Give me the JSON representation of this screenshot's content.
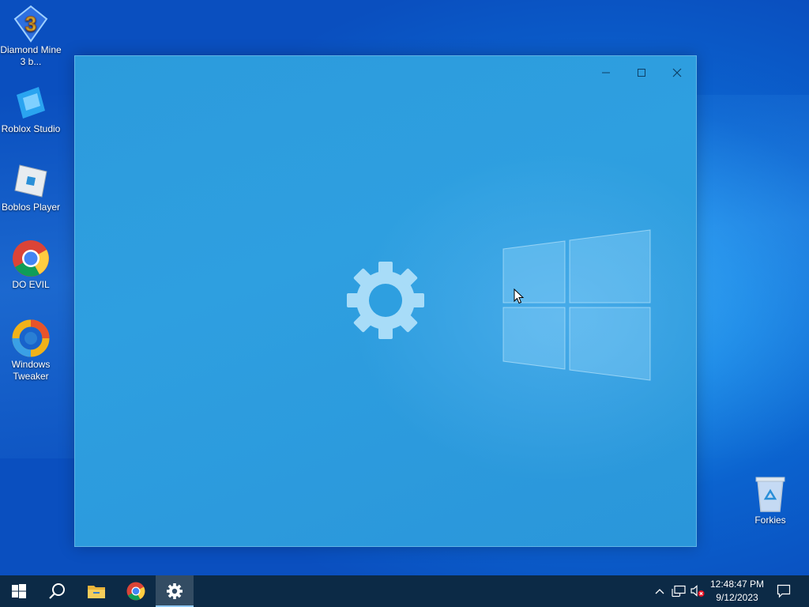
{
  "desktop": {
    "icons": [
      {
        "label": "Diamond Mine 3 b...",
        "icon": "diamond-mine-icon"
      },
      {
        "label": "Roblox Studio",
        "icon": "roblox-studio-icon"
      },
      {
        "label": "Boblos Player",
        "icon": "roblox-player-icon"
      },
      {
        "label": "DO EVIL",
        "icon": "chrome-icon"
      },
      {
        "label": "Windows Tweaker",
        "icon": "windows-tweaker-icon"
      },
      {
        "label": "Forkies",
        "icon": "recycle-bin-icon"
      }
    ]
  },
  "window": {
    "center_icon": "gear-icon",
    "logo": "windows-logo",
    "controls": [
      "minimize-icon",
      "maximize-icon",
      "close-icon"
    ]
  },
  "taskbar": {
    "items": [
      "start-icon",
      "search-icon",
      "file-explorer-icon",
      "chrome-icon",
      "settings-icon"
    ],
    "active": "settings-icon",
    "tray": [
      "chevron-up-icon",
      "network-icon",
      "volume-muted-icon",
      "notification-icon"
    ],
    "time": "12:48:47 PM",
    "date": "9/12/2023"
  },
  "colors": {
    "accent": "#2e9fe0",
    "taskbar": "#0c2a46",
    "gear": "#a8dcf8"
  }
}
